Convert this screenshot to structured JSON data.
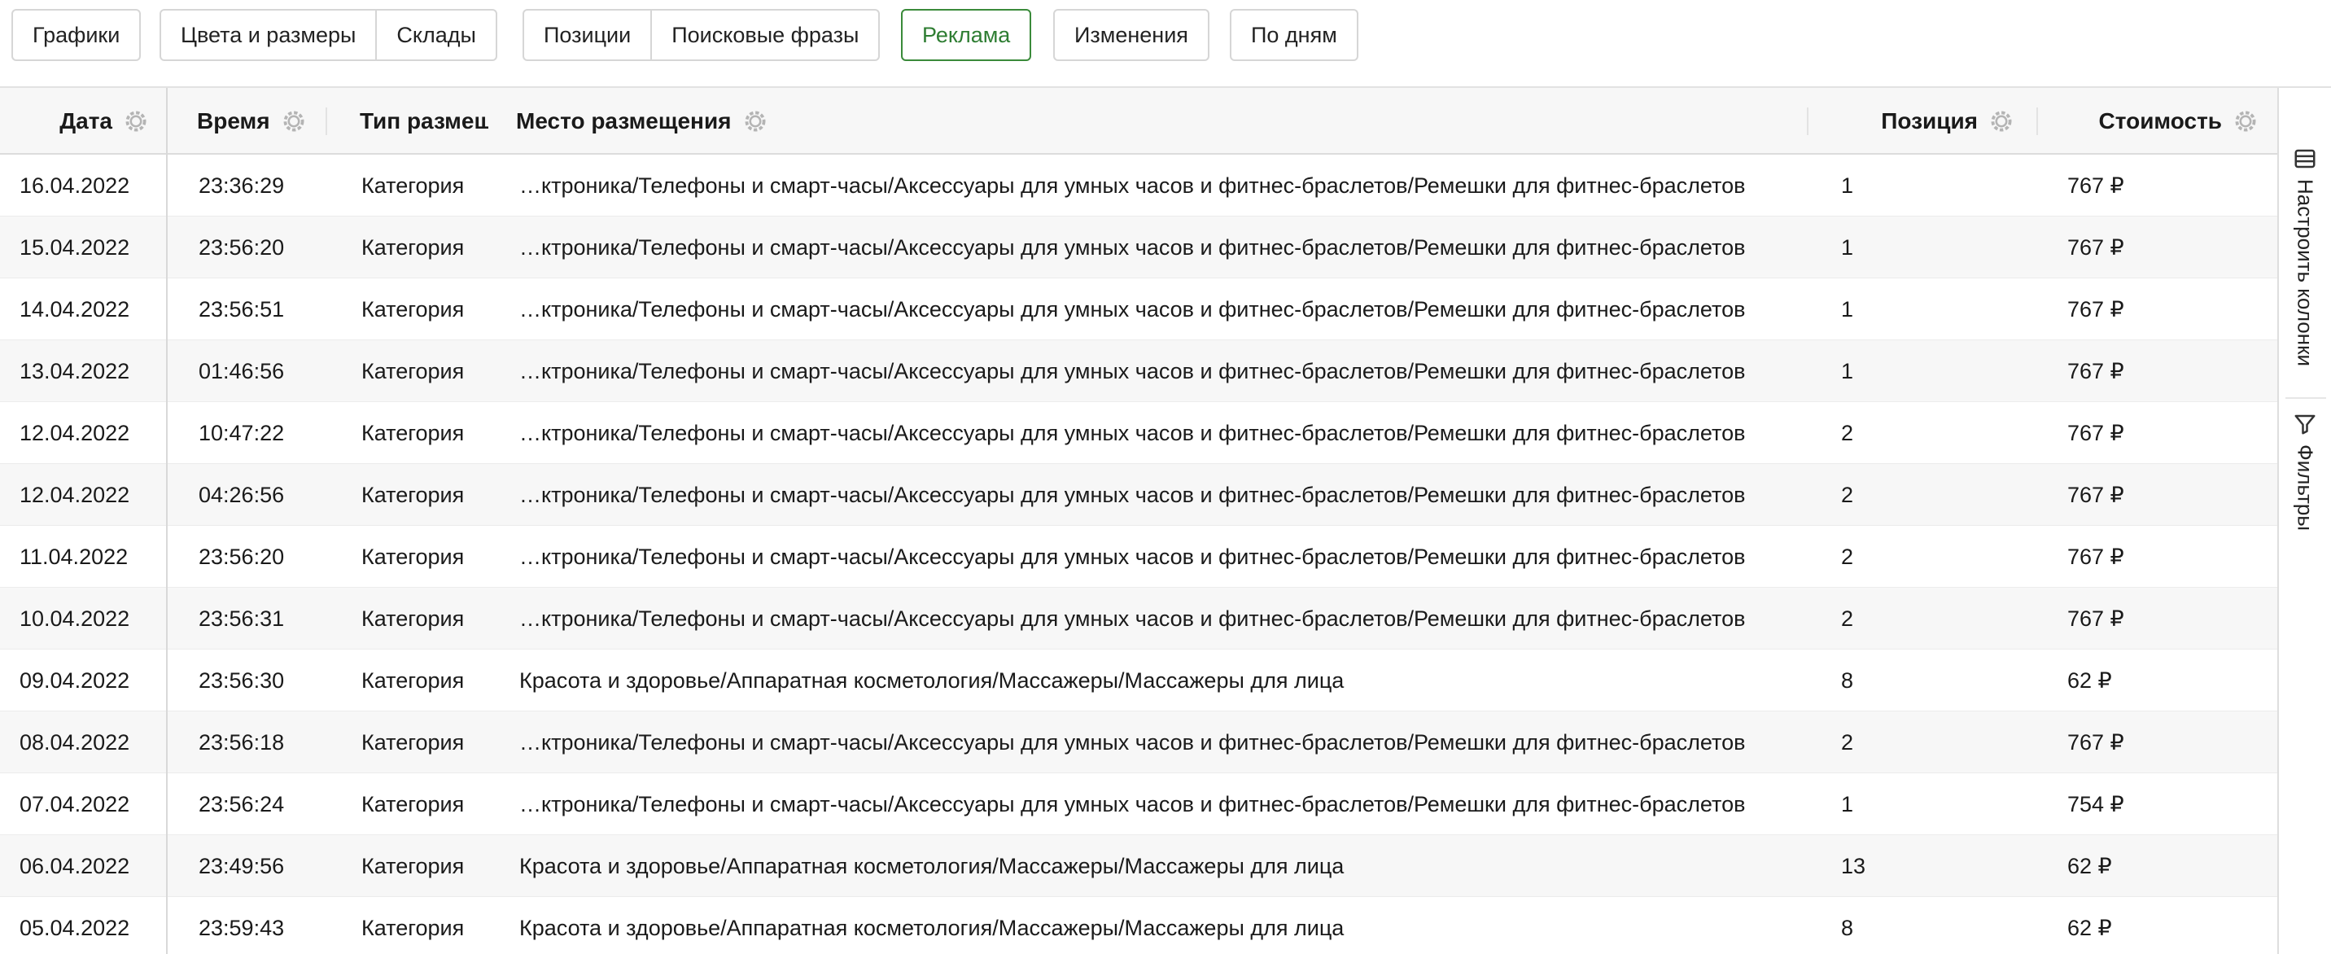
{
  "tabs": [
    [
      {
        "label": "Графики"
      }
    ],
    [
      {
        "label": "Цвета и размеры"
      },
      {
        "label": "Склады"
      }
    ],
    [
      {
        "label": "Позиции"
      },
      {
        "label": "Поисковые фразы"
      }
    ],
    [
      {
        "label": "Реклама",
        "active": true
      }
    ],
    [
      {
        "label": "Изменения"
      }
    ],
    [
      {
        "label": "По дням"
      }
    ]
  ],
  "columns": {
    "date": "Дата",
    "time": "Время",
    "type": "Тип размещения",
    "place": "Место размещения",
    "position": "Позиция",
    "cost": "Стоимость"
  },
  "rows": [
    {
      "date": "16.04.2022",
      "time": "23:36:29",
      "type": "Категория",
      "place": "…ктроника/Телефоны и смарт-часы/Аксессуары для умных часов и фитнес-браслетов/Ремешки для фитнес-браслетов",
      "position": "1",
      "cost": "767 ₽"
    },
    {
      "date": "15.04.2022",
      "time": "23:56:20",
      "type": "Категория",
      "place": "…ктроника/Телефоны и смарт-часы/Аксессуары для умных часов и фитнес-браслетов/Ремешки для фитнес-браслетов",
      "position": "1",
      "cost": "767 ₽"
    },
    {
      "date": "14.04.2022",
      "time": "23:56:51",
      "type": "Категория",
      "place": "…ктроника/Телефоны и смарт-часы/Аксессуары для умных часов и фитнес-браслетов/Ремешки для фитнес-браслетов",
      "position": "1",
      "cost": "767 ₽"
    },
    {
      "date": "13.04.2022",
      "time": "01:46:56",
      "type": "Категория",
      "place": "…ктроника/Телефоны и смарт-часы/Аксессуары для умных часов и фитнес-браслетов/Ремешки для фитнес-браслетов",
      "position": "1",
      "cost": "767 ₽"
    },
    {
      "date": "12.04.2022",
      "time": "10:47:22",
      "type": "Категория",
      "place": "…ктроника/Телефоны и смарт-часы/Аксессуары для умных часов и фитнес-браслетов/Ремешки для фитнес-браслетов",
      "position": "2",
      "cost": "767 ₽"
    },
    {
      "date": "12.04.2022",
      "time": "04:26:56",
      "type": "Категория",
      "place": "…ктроника/Телефоны и смарт-часы/Аксессуары для умных часов и фитнес-браслетов/Ремешки для фитнес-браслетов",
      "position": "2",
      "cost": "767 ₽"
    },
    {
      "date": "11.04.2022",
      "time": "23:56:20",
      "type": "Категория",
      "place": "…ктроника/Телефоны и смарт-часы/Аксессуары для умных часов и фитнес-браслетов/Ремешки для фитнес-браслетов",
      "position": "2",
      "cost": "767 ₽"
    },
    {
      "date": "10.04.2022",
      "time": "23:56:31",
      "type": "Категория",
      "place": "…ктроника/Телефоны и смарт-часы/Аксессуары для умных часов и фитнес-браслетов/Ремешки для фитнес-браслетов",
      "position": "2",
      "cost": "767 ₽"
    },
    {
      "date": "09.04.2022",
      "time": "23:56:30",
      "type": "Категория",
      "place": "Красота и здоровье/Аппаратная косметология/Массажеры/Массажеры для лица",
      "position": "8",
      "cost": "62 ₽"
    },
    {
      "date": "08.04.2022",
      "time": "23:56:18",
      "type": "Категория",
      "place": "…ктроника/Телефоны и смарт-часы/Аксессуары для умных часов и фитнес-браслетов/Ремешки для фитнес-браслетов",
      "position": "2",
      "cost": "767 ₽"
    },
    {
      "date": "07.04.2022",
      "time": "23:56:24",
      "type": "Категория",
      "place": "…ктроника/Телефоны и смарт-часы/Аксессуары для умных часов и фитнес-браслетов/Ремешки для фитнес-браслетов",
      "position": "1",
      "cost": "754 ₽"
    },
    {
      "date": "06.04.2022",
      "time": "23:49:56",
      "type": "Категория",
      "place": "Красота и здоровье/Аппаратная косметология/Массажеры/Массажеры для лица",
      "position": "13",
      "cost": "62 ₽"
    },
    {
      "date": "05.04.2022",
      "time": "23:59:43",
      "type": "Категория",
      "place": "Красота и здоровье/Аппаратная косметология/Массажеры/Массажеры для лица",
      "position": "8",
      "cost": "62 ₽"
    }
  ],
  "side": {
    "columns_label": "Настроить колонки",
    "filters_label": "Фильтры"
  },
  "icons": {
    "column_settings": "gear-icon",
    "columns": "columns-icon",
    "filters": "filter-icon"
  },
  "colors": {
    "accent": "#2e7d32",
    "header_bg": "#f7f7f7",
    "row_alt_bg": "#f7f7f7"
  }
}
